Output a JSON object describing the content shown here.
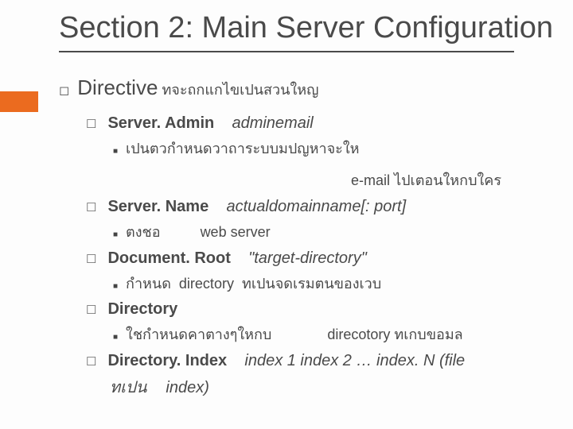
{
  "title": "Section 2: Main Server Configuration",
  "directive": {
    "label": "Directive",
    "note": "ทจะถกแกไขเปนสวนใหญ"
  },
  "items": [
    {
      "name": "Server. Admin",
      "arg": "adminemail",
      "sub": {
        "pre": "เปนตวกำหนดวาถาระบบมปญหาจะให",
        "mid": "e-mail",
        "post": "ไปเตอนใหกบใคร"
      }
    },
    {
      "name": "Server. Name",
      "arg": "actualdomainname[: port]",
      "sub": {
        "pre": "ตงชอ",
        "mid": "web server",
        "post": ""
      }
    },
    {
      "name": "Document. Root",
      "arg": "\"target-directory\"",
      "sub": {
        "pre": "กำหนด",
        "mid": "directory",
        "post": "ทเปนจดเรมตนของเวบ"
      }
    },
    {
      "name": "Directory",
      "arg": "",
      "sub": {
        "pre": "ใชกำหนดคาตางๆใหกบ",
        "mid": "direcotory",
        "post": "ทเกบขอมล"
      }
    },
    {
      "name": "Directory. Index",
      "arg": "index 1  index 2 … index. N (file",
      "tail_pre": "ทเปน",
      "tail_post": "index)"
    }
  ]
}
